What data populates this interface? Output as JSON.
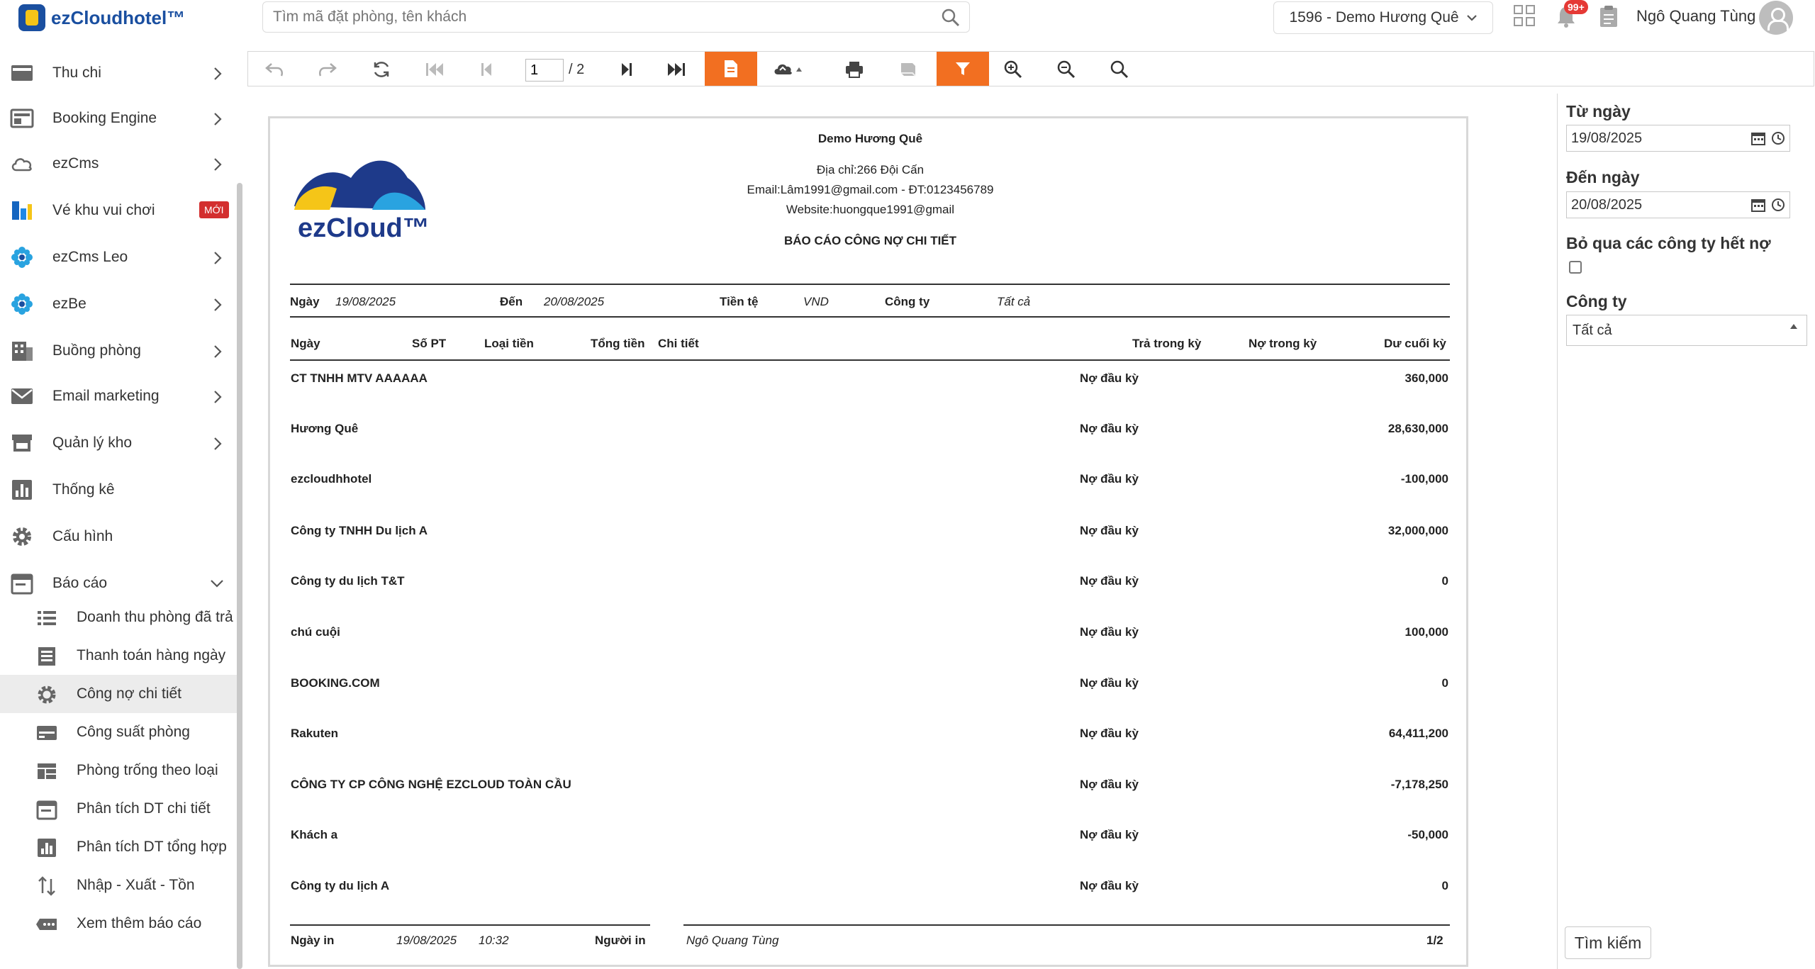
{
  "app": {
    "logo_text": "ezCloudhotel™"
  },
  "search": {
    "placeholder": "Tìm mã đặt phòng, tên khách"
  },
  "hotel": {
    "selected": "1596 - Demo Hương Quê"
  },
  "notifications": {
    "count": "99+"
  },
  "user": {
    "name": "Ngô Quang Tùng"
  },
  "sidebar": {
    "items": [
      {
        "label": "Thu chi"
      },
      {
        "label": "Booking Engine"
      },
      {
        "label": "ezCms"
      },
      {
        "label": "Vé khu vui chơi",
        "badge": "MỚI"
      },
      {
        "label": "ezCms Leo"
      },
      {
        "label": "ezBe"
      },
      {
        "label": "Buồng phòng"
      },
      {
        "label": "Email marketing"
      },
      {
        "label": "Quản lý kho"
      },
      {
        "label": "Thống kê"
      },
      {
        "label": "Cấu hình"
      },
      {
        "label": "Báo cáo"
      }
    ],
    "sub_items": [
      {
        "label": "Doanh thu phòng đã trả"
      },
      {
        "label": "Thanh toán hàng ngày"
      },
      {
        "label": "Công nợ chi tiết"
      },
      {
        "label": "Công suất phòng"
      },
      {
        "label": "Phòng trống theo loại"
      },
      {
        "label": "Phân tích DT chi tiết"
      },
      {
        "label": "Phân tích DT tổng hợp"
      },
      {
        "label": "Nhập - Xuất - Tồn"
      },
      {
        "label": "Xem thêm báo cáo"
      }
    ]
  },
  "toolbar": {
    "page_current": "1",
    "page_total": "/ 2"
  },
  "report": {
    "hotel_name": "Demo Hương Quê",
    "address": "Địa chỉ:266 Đội Cấn",
    "contact": "Email:Lâm1991@gmail.com -  ĐT:0123456789",
    "website": "Website:huongque1991@gmail",
    "title": "BÁO CÁO CÔNG NỢ CHI TIẾT",
    "logo_text": "ezCloud™",
    "params": {
      "date_label": "Ngày",
      "date_value": "19/08/2025",
      "to_label": "Đến",
      "to_value": "20/08/2025",
      "currency_label": "Tiền tệ",
      "currency_value": "VND",
      "company_label": "Công ty",
      "company_value": "Tất cả"
    },
    "columns": [
      "Ngày",
      "Số PT",
      "Loại tiền",
      "Tổng tiền",
      "Chi tiết",
      "Trả trong kỳ",
      "Nợ trong kỳ",
      "Dư cuối kỳ"
    ],
    "rows": [
      {
        "company": "CT TNHH MTV AAAAAA",
        "type": "Nợ đầu kỳ",
        "amount": "360,000"
      },
      {
        "company": "Hương Quê",
        "type": "Nợ đầu kỳ",
        "amount": "28,630,000"
      },
      {
        "company": "ezcloudhhotel",
        "type": "Nợ đầu kỳ",
        "amount": "-100,000"
      },
      {
        "company": "Công ty TNHH Du lịch A",
        "type": "Nợ đầu kỳ",
        "amount": "32,000,000"
      },
      {
        "company": "Công ty du lịch T&T",
        "type": "Nợ đầu kỳ",
        "amount": "0"
      },
      {
        "company": "chú cuội",
        "type": "Nợ đầu kỳ",
        "amount": "100,000"
      },
      {
        "company": "BOOKING.COM",
        "type": "Nợ đầu kỳ",
        "amount": "0"
      },
      {
        "company": "Rakuten",
        "type": "Nợ đầu kỳ",
        "amount": "64,411,200"
      },
      {
        "company": "CÔNG TY CP CÔNG NGHỆ EZCLOUD TOÀN CẦU",
        "type": "Nợ đầu kỳ",
        "amount": "-7,178,250"
      },
      {
        "company": "Khách a",
        "type": "Nợ đầu kỳ",
        "amount": "-50,000"
      },
      {
        "company": "Công ty du lịch A",
        "type": "Nợ đầu kỳ",
        "amount": "0"
      }
    ],
    "footer": {
      "print_date_label": "Ngày in",
      "print_date": "19/08/2025",
      "print_time": "10:32",
      "printer_label": "Người in",
      "printer": "Ngô Quang Tùng",
      "page": "1/2"
    }
  },
  "filter": {
    "from_label": "Từ ngày",
    "from_value": "19/08/2025",
    "to_label": "Đến ngày",
    "to_value": "20/08/2025",
    "skip_label": "Bỏ qua các công ty hết nợ",
    "company_label": "Công ty",
    "company_value": "Tất cả",
    "search_button": "Tìm kiếm"
  },
  "colors": {
    "accent": "#f26f21",
    "brand": "#1a4fa0",
    "badge": "#e53935"
  }
}
